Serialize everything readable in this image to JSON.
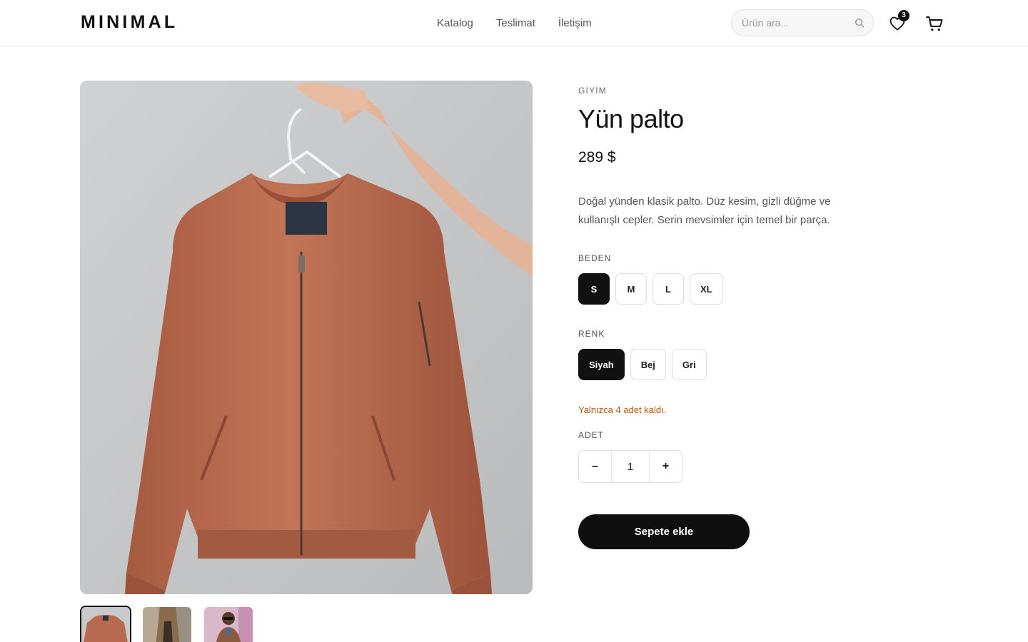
{
  "header": {
    "logo": "MINIMAL",
    "nav": [
      "Katalog",
      "Teslimat",
      "İletişim"
    ],
    "search_placeholder": "Ürün ara...",
    "wishlist_count": "3"
  },
  "product": {
    "category": "GİYİM",
    "title": "Yün palto",
    "price": "289 $",
    "description": "Doğal yünden klasik palto. Düz kesim, gizli düğme ve kullanışlı cepler. Serin mevsimler için temel bir parça.",
    "size_label": "BEDEN",
    "sizes": [
      "S",
      "M",
      "L",
      "XL"
    ],
    "selected_size": "S",
    "color_label": "RENK",
    "colors": [
      "Siyah",
      "Bej",
      "Gri"
    ],
    "selected_color": "Siyah",
    "stock_message": "Yalnızca 4 adet kaldı.",
    "quantity_label": "ADET",
    "quantity": "1",
    "qty_minus": "–",
    "qty_plus": "+",
    "add_to_cart": "Sepete ekle"
  },
  "gallery": {
    "thumbnail_count": 3,
    "active_thumbnail": 0
  },
  "colors": {
    "accent": "#111111",
    "stock_warning": "#b45309",
    "jacket": "#b86a50"
  }
}
